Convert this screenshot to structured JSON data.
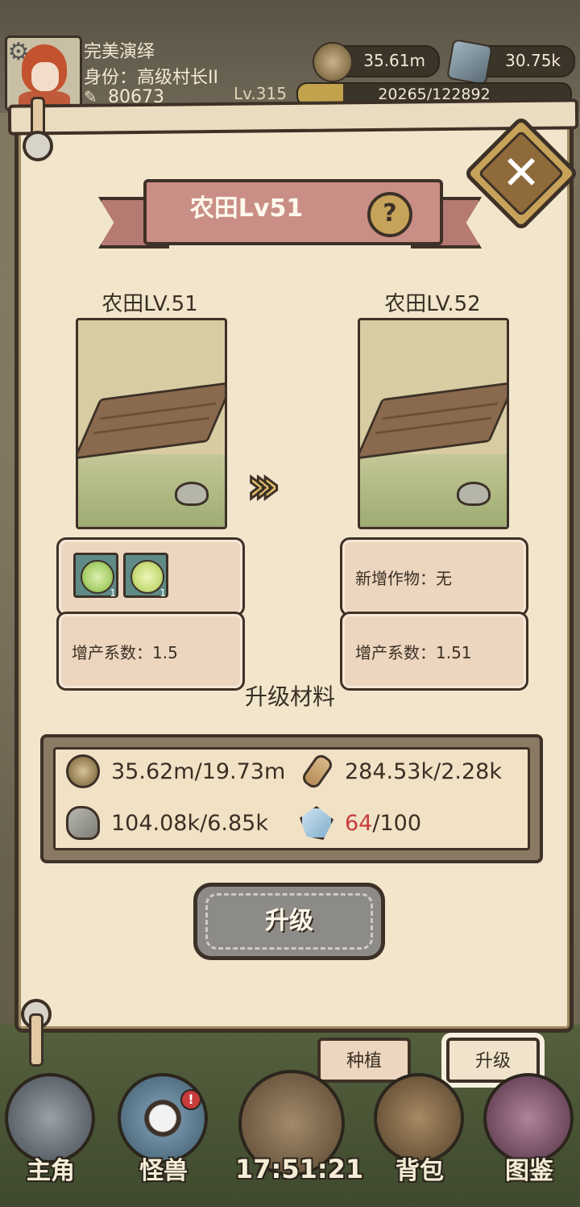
{
  "player": {
    "name": "完美演绎",
    "title": "身份：高级村长II",
    "power": "80673",
    "level": "Lv.315",
    "xp_text": "20265/122892",
    "xp_progress": 0.165
  },
  "resources": {
    "coins": "35.61m",
    "ore": "30.75k"
  },
  "dialog": {
    "title": "农田Lv51",
    "current_level_label": "农田LV.51",
    "next_level_label": "农田LV.52",
    "crops": [
      {
        "name": "cabbage",
        "count": "1"
      },
      {
        "name": "melon",
        "count": "1"
      }
    ],
    "current_yield": "增产系数：1.5",
    "new_crops": "新增作物：无",
    "next_yield": "增产系数：1.51",
    "materials_title": "升级材料",
    "materials": {
      "coins": "35.62m/19.73m",
      "wood": "284.53k/2.28k",
      "stone": "104.08k/6.85k",
      "crystal_have": "64",
      "crystal_need": "/100"
    },
    "upgrade_button": "升级",
    "tabs": {
      "plant": "种植",
      "upgrade": "升级"
    }
  },
  "nav": {
    "hero": "主角",
    "monsters": "怪兽",
    "bag": "背包",
    "codex": "图鉴",
    "clock": "17:51:21",
    "monster_badge": "!"
  },
  "colors": {
    "insufficient": "#c83b3b",
    "ribbon": "#c98f86",
    "panel": "#f1e6cc"
  }
}
